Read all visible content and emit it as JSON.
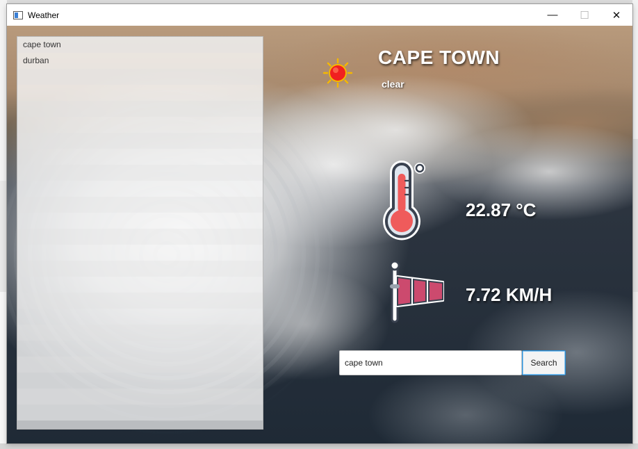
{
  "window": {
    "title": "Weather",
    "controls": {
      "minimize": "—",
      "maximize": "☐",
      "close": "✕"
    }
  },
  "cities": [
    "cape town",
    "durban"
  ],
  "current": {
    "city": "CAPE TOWN",
    "condition": "clear",
    "temperature": "22.87 °C",
    "wind_speed": "7.72 KM/H"
  },
  "search": {
    "value": "cape town",
    "button_label": "Search"
  },
  "icons": {
    "weather": "sun-icon",
    "temperature": "thermometer-icon",
    "wind": "windsock-icon"
  },
  "colors": {
    "sun": "#f02020",
    "sun_rays": "#f5b800",
    "thermometer_fill": "#ef5b5b",
    "windsock": "#cc4a6e",
    "focus_border": "#2c8fd6"
  }
}
